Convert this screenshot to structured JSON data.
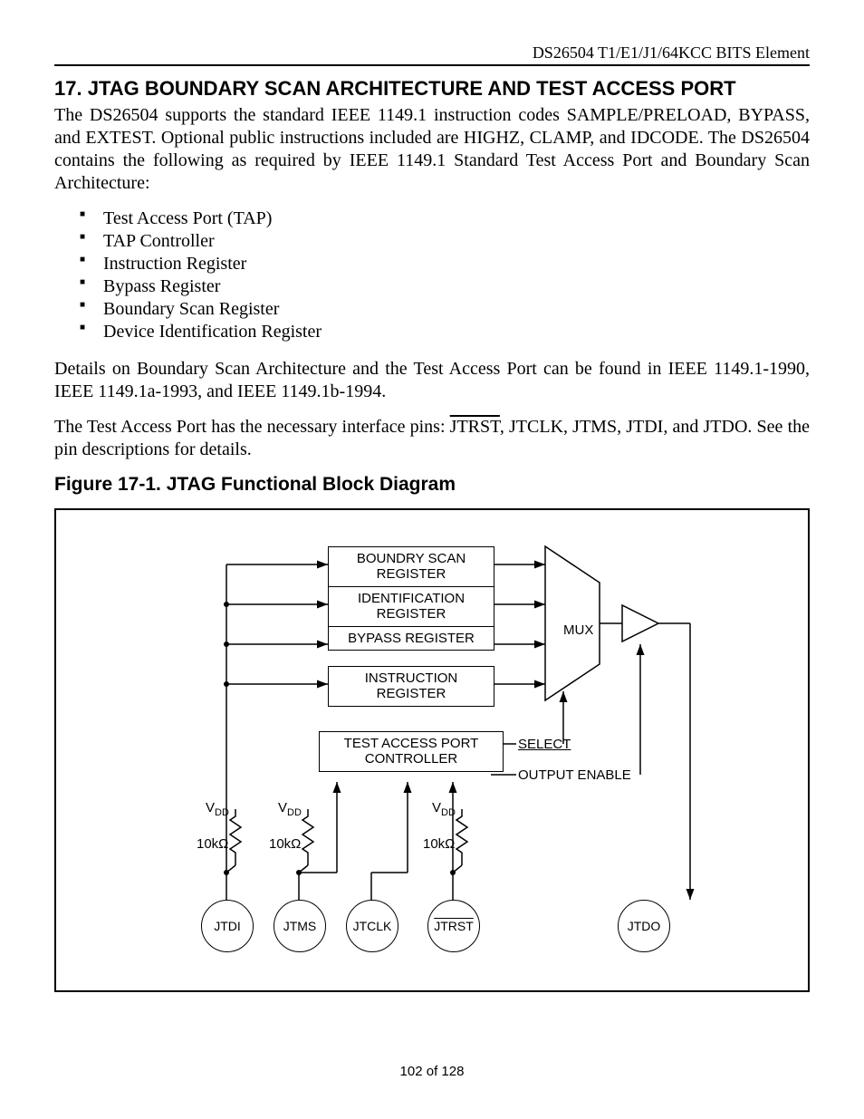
{
  "header": {
    "running_head": "DS26504 T1/E1/J1/64KCC BITS Element"
  },
  "section": {
    "number": "17.",
    "title": "JTAG BOUNDARY SCAN ARCHITECTURE AND TEST ACCESS PORT"
  },
  "paragraphs": {
    "p1": "The DS26504 supports the standard IEEE 1149.1 instruction codes SAMPLE/PRELOAD, BYPASS, and EXTEST. Optional public instructions included are HIGHZ, CLAMP, and IDCODE. The DS26504 contains the following as required by IEEE 1149.1 Standard Test Access Port and Boundary Scan Architecture:",
    "p2": "Details on Boundary Scan Architecture and the Test Access Port can be found in IEEE 1149.1-1990, IEEE 1149.1a-1993, and IEEE 1149.1b-1994.",
    "p3_a": "The Test Access Port has the necessary interface pins: ",
    "p3_b": "JTRST",
    "p3_c": ", JTCLK, JTMS, JTDI, and JTDO. See the pin descriptions for details."
  },
  "bullets": [
    "Test Access Port (TAP)",
    "TAP Controller",
    "Instruction Register",
    "Bypass Register",
    "Boundary Scan Register",
    "Device Identification Register"
  ],
  "figure": {
    "caption": "Figure 17-1. JTAG Functional Block Diagram",
    "blocks": {
      "boundary_scan_register": "BOUNDRY SCAN REGISTER",
      "identification_register": "IDENTIFICATION REGISTER",
      "bypass_register": "BYPASS REGISTER",
      "instruction_register": "INSTRUCTION REGISTER",
      "tap_controller": "TEST ACCESS PORT CONTROLLER",
      "mux": "MUX",
      "select": "SELECT",
      "output_enable": "OUTPUT ENABLE"
    },
    "supply": "V",
    "supply_sub": "DD",
    "resistor": "10kΩ",
    "pins": {
      "jtdi": "JTDI",
      "jtms": "JTMS",
      "jtclk": "JTCLK",
      "jtrst": "JTRST",
      "jtdo": "JTDO"
    }
  },
  "footer": {
    "page": "102 of 128"
  }
}
